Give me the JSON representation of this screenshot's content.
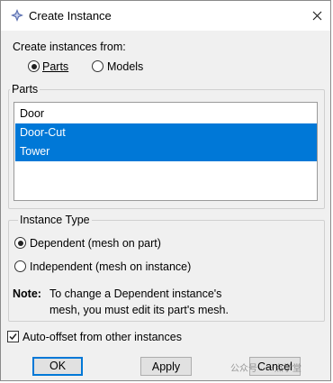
{
  "window": {
    "title": "Create Instance",
    "icon": "abaqus-logo-icon",
    "close_icon": "close-icon"
  },
  "create_from": {
    "label": "Create instances from:",
    "options": [
      {
        "label": "Parts",
        "selected": true
      },
      {
        "label": "Models",
        "selected": false
      }
    ]
  },
  "parts": {
    "group_label": "Parts",
    "items": [
      {
        "label": "Door",
        "selected": false
      },
      {
        "label": "Door-Cut",
        "selected": true
      },
      {
        "label": "Tower",
        "selected": true
      }
    ]
  },
  "instance_type": {
    "group_label": "Instance Type",
    "options": [
      {
        "label": "Dependent (mesh on part)",
        "selected": true
      },
      {
        "label": "Independent (mesh on instance)",
        "selected": false
      }
    ],
    "note_label": "Note:",
    "note_line1": "To change a Dependent instance's",
    "note_line2": "mesh, you must edit its part's mesh."
  },
  "auto_offset": {
    "label": "Auto-offset from other instances",
    "checked": true
  },
  "buttons": {
    "ok": "OK",
    "apply": "Apply",
    "cancel": "Cancel"
  },
  "watermark": "公众号 · 一点学堂",
  "colors": {
    "selection": "#0078d7",
    "default_button_border": "#0078d7"
  }
}
